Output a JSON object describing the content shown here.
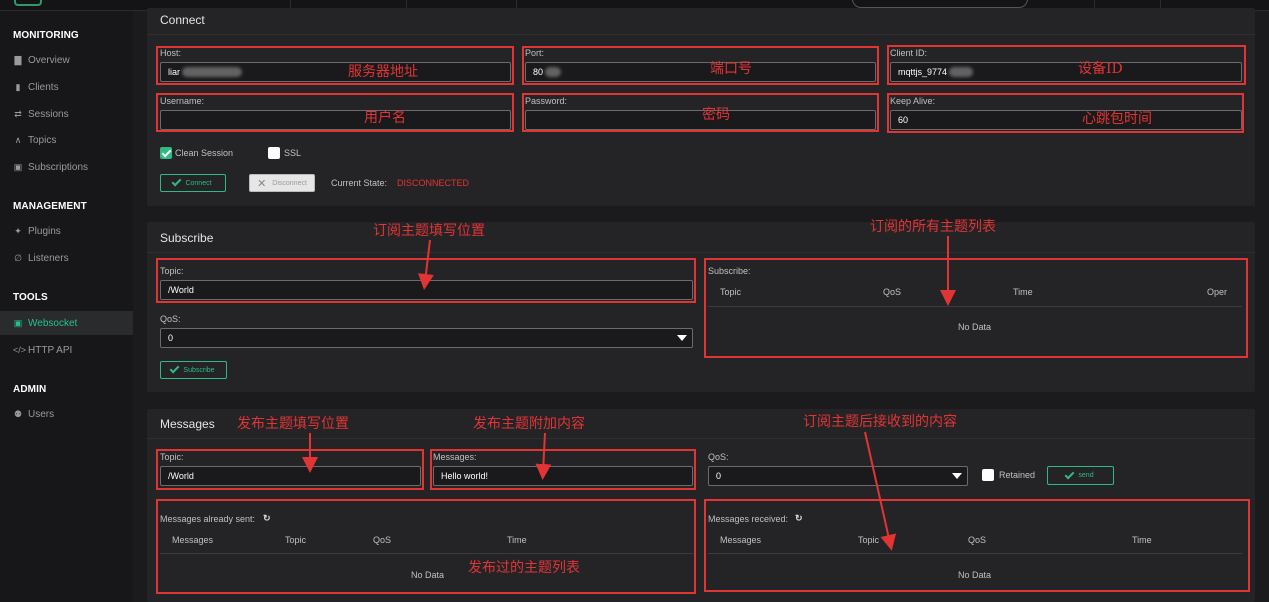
{
  "sidebar": {
    "sections": [
      {
        "title": "MONITORING",
        "items": [
          {
            "label": "Overview",
            "icon": "chart-icon"
          },
          {
            "label": "Clients",
            "icon": "clients-icon"
          },
          {
            "label": "Sessions",
            "icon": "sessions-icon"
          },
          {
            "label": "Topics",
            "icon": "topics-icon"
          },
          {
            "label": "Subscriptions",
            "icon": "subscriptions-icon"
          }
        ]
      },
      {
        "title": "MANAGEMENT",
        "items": [
          {
            "label": "Plugins",
            "icon": "plug-icon"
          },
          {
            "label": "Listeners",
            "icon": "listener-icon"
          }
        ]
      },
      {
        "title": "TOOLS",
        "items": [
          {
            "label": "Websocket",
            "icon": "websocket-icon",
            "active": true
          },
          {
            "label": "HTTP API",
            "icon": "code-icon"
          }
        ]
      },
      {
        "title": "ADMIN",
        "items": [
          {
            "label": "Users",
            "icon": "user-icon"
          }
        ]
      }
    ]
  },
  "connect": {
    "title": "Connect",
    "host_label": "Host:",
    "host_value": "liar",
    "port_label": "Port:",
    "port_value": "80",
    "clientid_label": "Client ID:",
    "clientid_value": "mqttjs_9774",
    "username_label": "Username:",
    "username_value": "",
    "password_label": "Password:",
    "password_value": "",
    "keepalive_label": "Keep Alive:",
    "keepalive_value": "60",
    "clean_session_label": "Clean Session",
    "clean_session_checked": true,
    "ssl_label": "SSL",
    "ssl_checked": false,
    "connect_button": "Connect",
    "disconnect_button": "Disconnect",
    "state_label": "Current State:",
    "state_value": "DISCONNECTED",
    "state_color": "#e23434"
  },
  "subscribe": {
    "title": "Subscribe",
    "topic_label": "Topic:",
    "topic_value": "/World",
    "qos_label": "QoS:",
    "qos_value": "0",
    "subscribe_button": "Subscribe",
    "list_label": "Subscribe:",
    "columns": [
      "Topic",
      "QoS",
      "Time",
      "Oper"
    ],
    "empty_text": "No Data"
  },
  "messages": {
    "title": "Messages",
    "topic_label": "Topic:",
    "topic_value": "/World",
    "messages_label": "Messages:",
    "messages_value": "Hello world!",
    "qos_label": "QoS:",
    "qos_value": "0",
    "retained_label": "Retained",
    "send_button": "send",
    "sent_label": "Messages already sent:",
    "sent_columns": [
      "Messages",
      "Topic",
      "QoS",
      "Time"
    ],
    "sent_empty": "No Data",
    "received_label": "Messages received:",
    "received_columns": [
      "Messages",
      "Topic",
      "QoS",
      "Time"
    ],
    "received_empty": "No Data"
  },
  "annotations": {
    "host": "服务器地址",
    "port": "端口号",
    "clientid": "设备ID",
    "username": "用户名",
    "password": "密码",
    "keepalive": "心跳包时间",
    "sub_topic": "订阅主题填写位置",
    "sub_list": "订阅的所有主题列表",
    "pub_topic": "发布主题填写位置",
    "pub_msg": "发布主题附加内容",
    "received": "订阅主题后接收到的内容",
    "sent_list": "发布过的主题列表"
  },
  "colors": {
    "accent": "#2fb983",
    "annotation": "#e23434",
    "panel": "#242427",
    "background": "#1b1b1d"
  }
}
